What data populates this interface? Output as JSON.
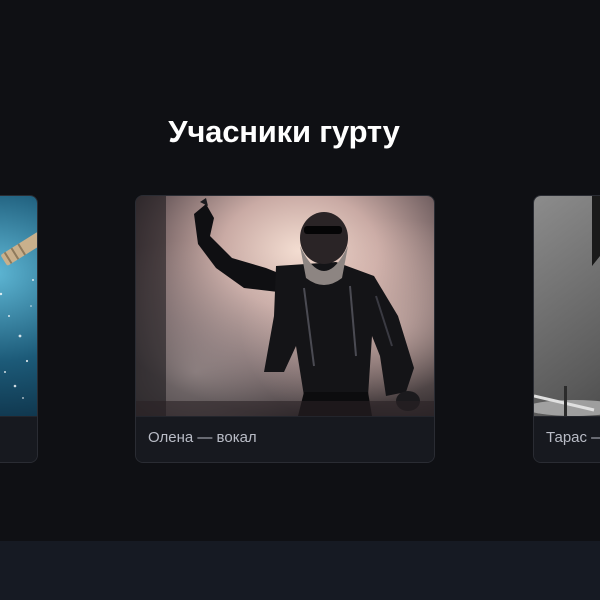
{
  "section": {
    "title": "Учасники гурту"
  },
  "carousel": {
    "members": [
      {
        "caption": "",
        "image": "starry-stage-photo"
      },
      {
        "caption": "Олена — вокал",
        "image": "singer-on-stage-photo"
      },
      {
        "caption": "Тарас — ",
        "image": "drummer-bw-photo"
      }
    ]
  },
  "colors": {
    "background": "#0f1014",
    "card": "#17191f",
    "card_border": "#2a2c33",
    "caption_text": "#b9bcc6",
    "title_text": "#ffffff",
    "footer": "#161a23"
  }
}
